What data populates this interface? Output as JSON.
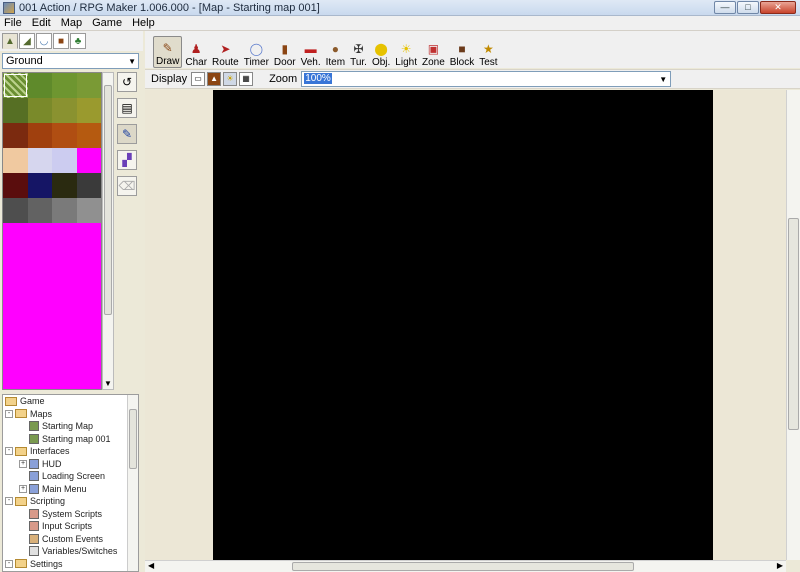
{
  "window": {
    "title": "001 Action / RPG Maker 1.006.000 - [Map - Starting map 001]"
  },
  "menu": [
    "File",
    "Edit",
    "Map",
    "Game",
    "Help"
  ],
  "layer_select": {
    "value": "Ground"
  },
  "toolbar": [
    {
      "label": "Draw",
      "icon": "pencil-icon",
      "active": true
    },
    {
      "label": "Char",
      "icon": "character-icon"
    },
    {
      "label": "Route",
      "icon": "route-icon"
    },
    {
      "label": "Timer",
      "icon": "timer-icon"
    },
    {
      "label": "Door",
      "icon": "door-icon"
    },
    {
      "label": "Veh.",
      "icon": "vehicle-icon"
    },
    {
      "label": "Item",
      "icon": "item-icon"
    },
    {
      "label": "Tur.",
      "icon": "turret-icon"
    },
    {
      "label": "Obj.",
      "icon": "object-icon"
    },
    {
      "label": "Light",
      "icon": "light-icon"
    },
    {
      "label": "Zone",
      "icon": "zone-icon"
    },
    {
      "label": "Block",
      "icon": "block-icon"
    },
    {
      "label": "Test",
      "icon": "test-icon"
    }
  ],
  "viewbar": {
    "display_label": "Display",
    "zoom_label": "Zoom",
    "zoom_value": "100%"
  },
  "tree": {
    "game": "Game",
    "maps": "Maps",
    "map_items": [
      "Starting Map",
      "Starting map 001"
    ],
    "interfaces": "Interfaces",
    "interface_items": [
      "HUD",
      "Loading Screen",
      "Main Menu"
    ],
    "scripting": "Scripting",
    "scripting_items": [
      "System Scripts",
      "Input Scripts",
      "Custom Events",
      "Variables/Switches"
    ],
    "settings": "Settings"
  },
  "colors": {
    "map_canvas": "#000000",
    "palette_empty": "#ff00ff"
  }
}
